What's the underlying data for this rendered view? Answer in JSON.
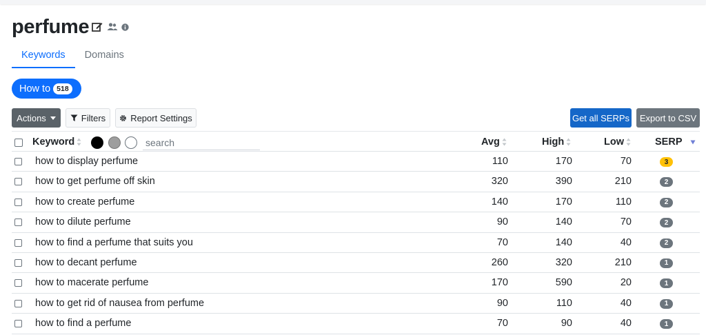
{
  "page": {
    "title": "perfume"
  },
  "tabs": [
    {
      "label": "Keywords",
      "active": true
    },
    {
      "label": "Domains",
      "active": false
    }
  ],
  "group_pill": {
    "label": "How to",
    "count": "518"
  },
  "toolbar": {
    "actions_label": "Actions",
    "filters_label": "Filters",
    "report_settings_label": "Report Settings",
    "get_serps_label": "Get all SERPs",
    "export_label": "Export to CSV"
  },
  "table": {
    "headers": {
      "keyword": "Keyword",
      "avg": "Avg",
      "high": "High",
      "low": "Low",
      "serp": "SERP"
    },
    "search_placeholder": "search",
    "rows": [
      {
        "keyword": "how to display perfume",
        "avg": "110",
        "high": "170",
        "low": "70",
        "serp": "3"
      },
      {
        "keyword": "how to get perfume off skin",
        "avg": "320",
        "high": "390",
        "low": "210",
        "serp": "2"
      },
      {
        "keyword": "how to create perfume",
        "avg": "140",
        "high": "170",
        "low": "110",
        "serp": "2"
      },
      {
        "keyword": "how to dilute perfume",
        "avg": "90",
        "high": "140",
        "low": "70",
        "serp": "2"
      },
      {
        "keyword": "how to find a perfume that suits you",
        "avg": "70",
        "high": "140",
        "low": "40",
        "serp": "2"
      },
      {
        "keyword": "how to decant perfume",
        "avg": "260",
        "high": "320",
        "low": "210",
        "serp": "1"
      },
      {
        "keyword": "how to macerate perfume",
        "avg": "170",
        "high": "590",
        "low": "20",
        "serp": "1"
      },
      {
        "keyword": "how to get rid of nausea from perfume",
        "avg": "90",
        "high": "110",
        "low": "40",
        "serp": "1"
      },
      {
        "keyword": "how to find a perfume",
        "avg": "70",
        "high": "90",
        "low": "40",
        "serp": "1"
      }
    ]
  },
  "colors": {
    "primary": "#0d6efd",
    "badge_warning": "#ffc107",
    "badge_secondary": "#6c757d"
  },
  "icons": {
    "edit": "edit-icon",
    "users": "users-icon",
    "info": "info-icon",
    "filter": "filter-icon",
    "gear": "gear-icon",
    "sort": "sort-icon"
  }
}
